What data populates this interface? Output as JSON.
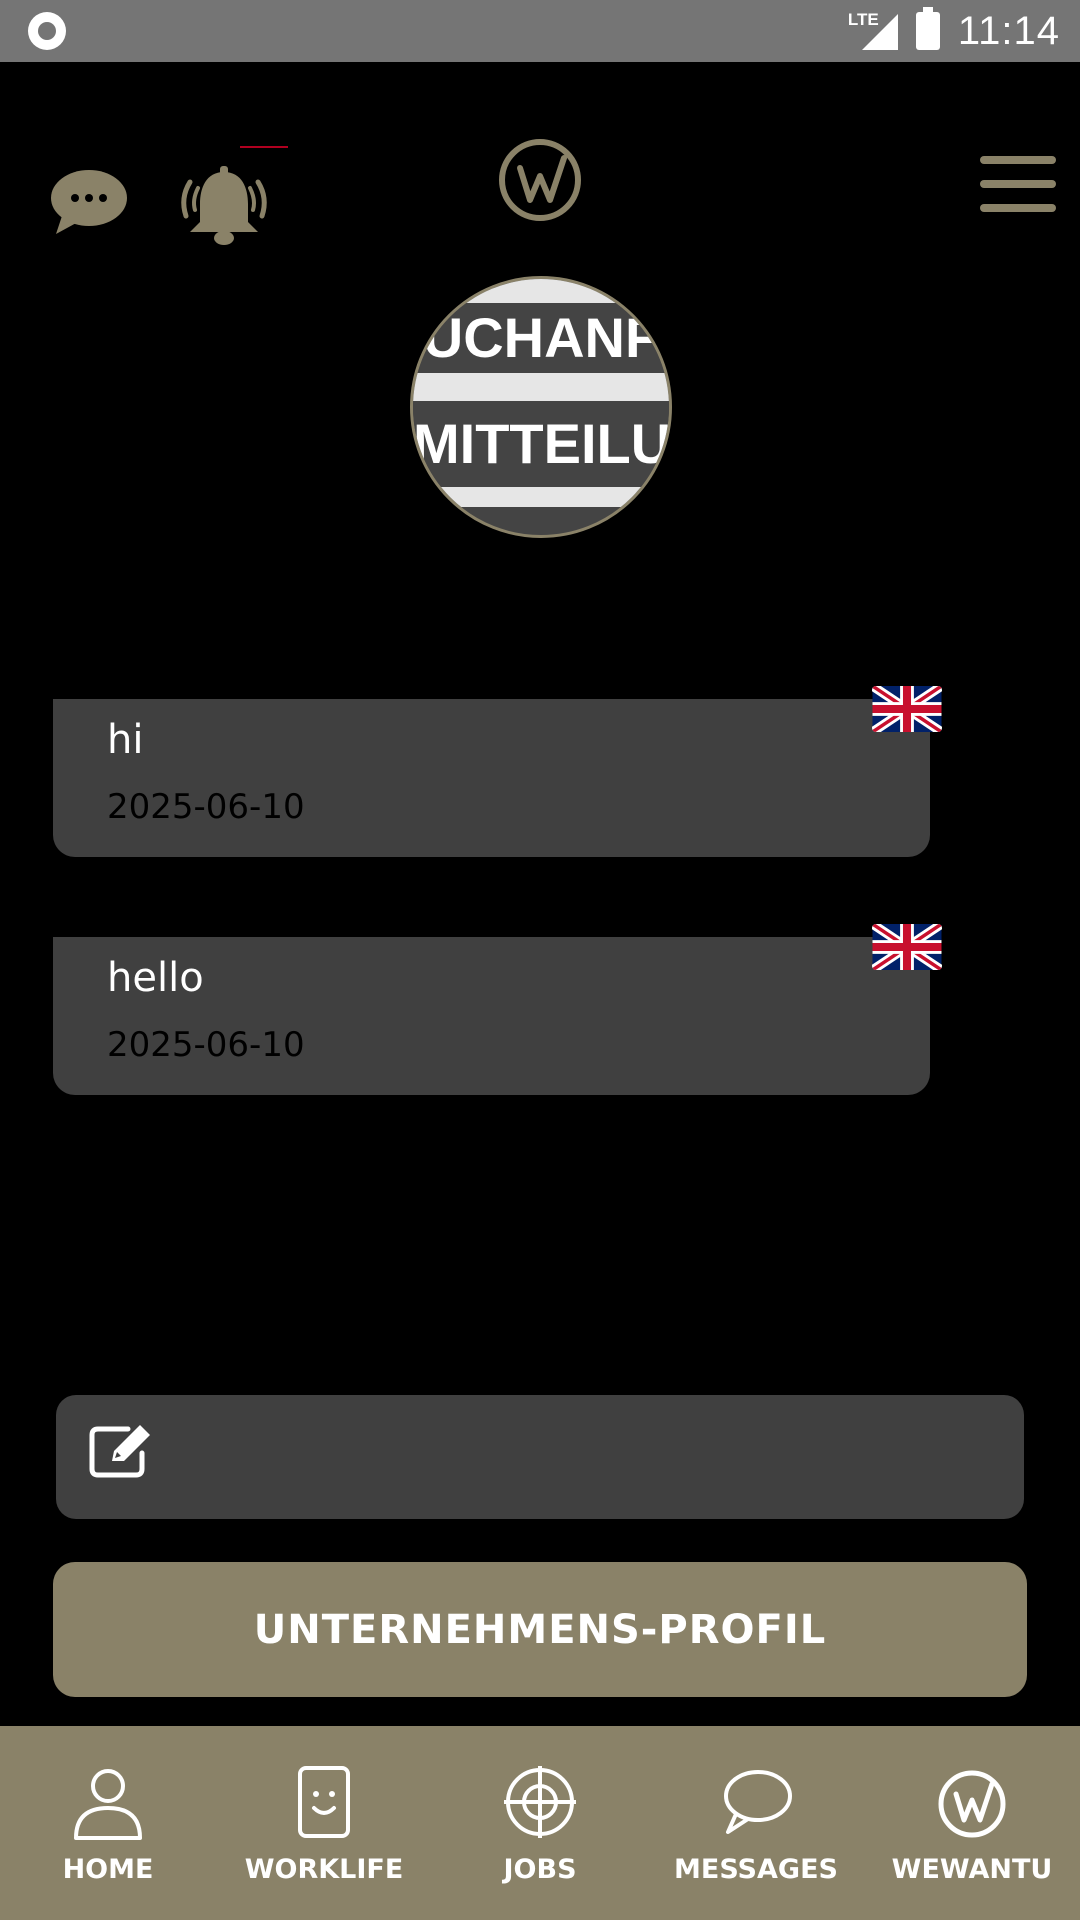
{
  "status_bar": {
    "network": "LTE",
    "time": "11:14"
  },
  "avatar": {
    "text_line_1": "UCHANF",
    "text_line_2": "MITTEILU"
  },
  "messages": [
    {
      "title": "hi",
      "date": "2025-06-10",
      "language_flag": "uk-flag-icon"
    },
    {
      "title": "hello",
      "date": "2025-06-10",
      "language_flag": "uk-flag-icon"
    }
  ],
  "compose": {
    "icon": "edit-icon",
    "value": ""
  },
  "profile_button": {
    "label": "UNTERNEHMENS-PROFIL"
  },
  "bottom_nav": {
    "items": [
      {
        "label": "HOME",
        "icon": "person-icon"
      },
      {
        "label": "WORKLIFE",
        "icon": "smiley-card-icon"
      },
      {
        "label": "JOBS",
        "icon": "crosshair-icon"
      },
      {
        "label": "MESSAGES",
        "icon": "speech-bubble-icon"
      },
      {
        "label": "WEWANTU",
        "icon": "wewantu-logo-icon"
      }
    ]
  },
  "colors": {
    "accent": "#8a8268",
    "card": "#404040",
    "background": "#000000",
    "status_bar": "#757575"
  }
}
